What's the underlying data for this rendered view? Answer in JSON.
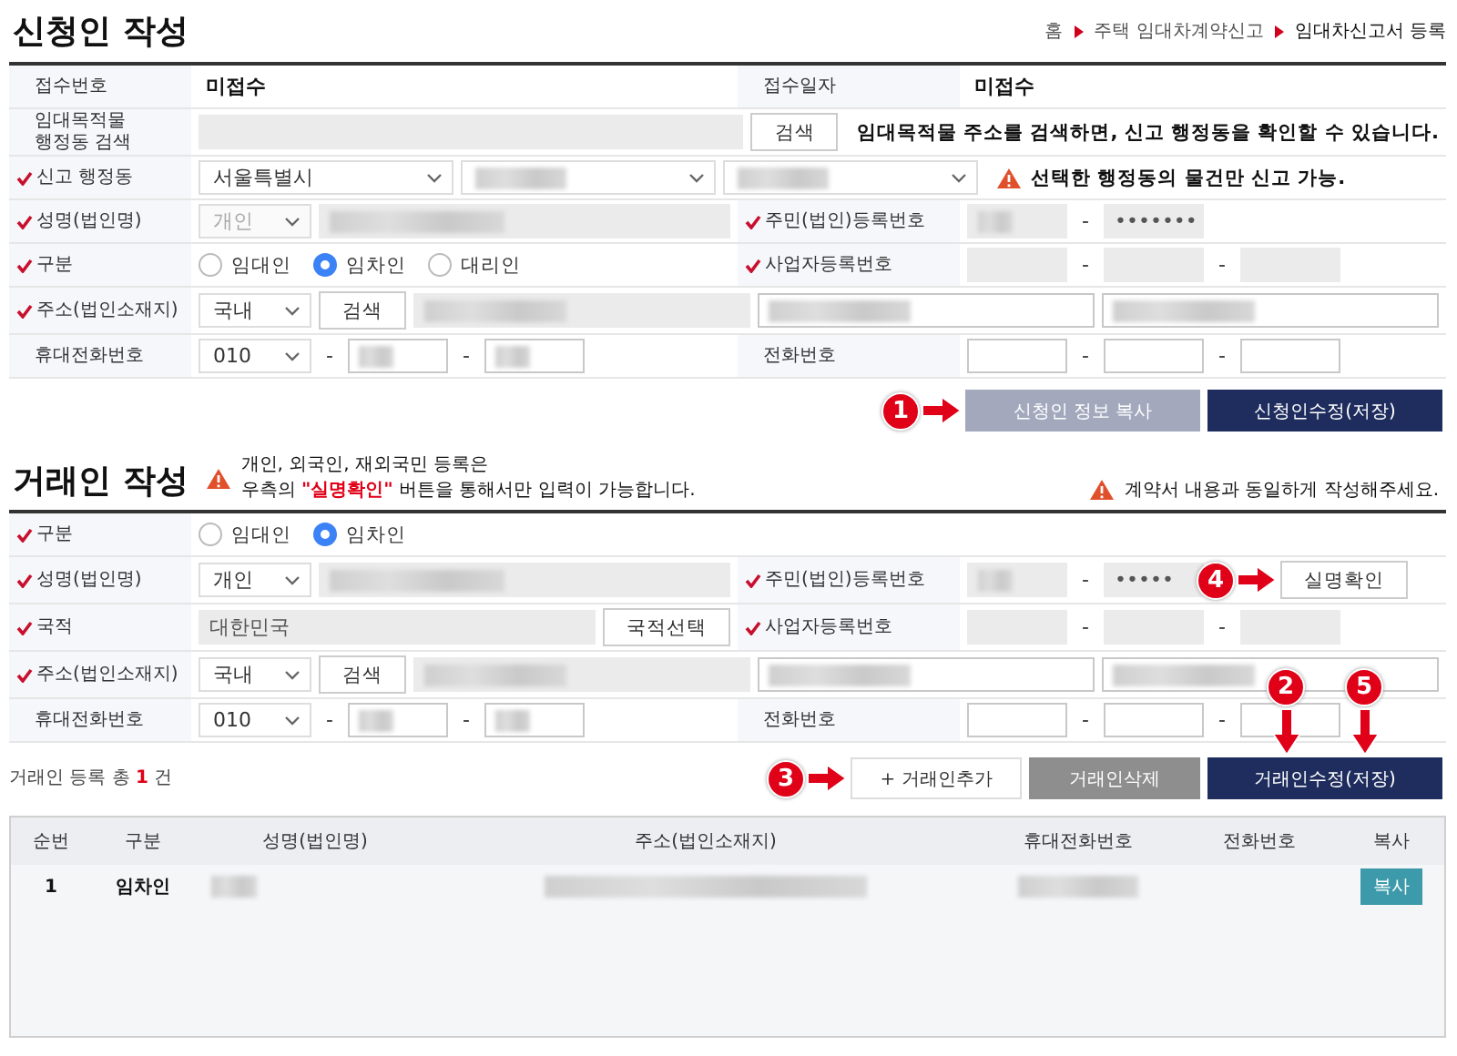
{
  "applicant": {
    "title": "신청인 작성",
    "breadcrumb": [
      "홈",
      "주택 임대차계약신고",
      "임대차신고서 등록"
    ],
    "rows": [
      {
        "cells": [
          {
            "label": "접수번호",
            "required": false,
            "items": [
              {
                "kind": "text",
                "text": "미접수"
              }
            ]
          },
          {
            "label": "접수일자",
            "required": false,
            "items": [
              {
                "kind": "text",
                "text": "미접수"
              }
            ]
          }
        ]
      },
      {
        "cells": [
          {
            "label": "임대목적물\n행정동 검색",
            "required": false,
            "items": [
              {
                "kind": "input",
                "readonly": true
              },
              {
                "kind": "button",
                "label": "검색"
              },
              {
                "kind": "note",
                "warning": false,
                "text": "임대목적물 주소를 검색하면, 신고 행정동을 확인할 수 있습니다."
              }
            ]
          }
        ]
      },
      {
        "cells": [
          {
            "label": "신고 행정동",
            "required": true,
            "items": [
              {
                "kind": "select",
                "value": "서울특별시",
                "disabled": false
              },
              {
                "kind": "select",
                "redacted": true,
                "disabled": false
              },
              {
                "kind": "select",
                "redacted": true,
                "disabled": false
              },
              {
                "kind": "note",
                "warning": true,
                "text": "선택한 행정동의 물건만 신고 가능."
              }
            ]
          }
        ]
      },
      {
        "cells": [
          {
            "label": "성명(법인명)",
            "required": true,
            "items": [
              {
                "kind": "select",
                "value": "개인",
                "disabled": true
              },
              {
                "kind": "input",
                "readonly": true,
                "redacted": true
              }
            ]
          },
          {
            "label": "주민(법인)등록번호",
            "required": true,
            "items": [
              {
                "kind": "input",
                "readonly": true,
                "redacted": true
              },
              {
                "kind": "dash",
                "text": "-"
              },
              {
                "kind": "input",
                "readonly": true,
                "value": "•••••••"
              }
            ]
          }
        ]
      },
      {
        "cells": [
          {
            "label": "구분",
            "required": true,
            "items": [
              {
                "kind": "radio",
                "options": [
                  {
                    "label": "임대인",
                    "selected": false
                  },
                  {
                    "label": "임차인",
                    "selected": true
                  },
                  {
                    "label": "대리인",
                    "selected": false
                  }
                ]
              }
            ]
          },
          {
            "label": "사업자등록번호",
            "required": true,
            "items": [
              {
                "kind": "input",
                "readonly": true
              },
              {
                "kind": "dash",
                "text": "-"
              },
              {
                "kind": "input",
                "readonly": true
              },
              {
                "kind": "dash",
                "text": "-"
              },
              {
                "kind": "input",
                "readonly": true
              }
            ]
          }
        ]
      },
      {
        "cells": [
          {
            "label": "주소(법인소재지)",
            "required": true,
            "items": [
              {
                "kind": "select",
                "value": "국내",
                "disabled": false
              },
              {
                "kind": "button",
                "label": "검색"
              },
              {
                "kind": "input",
                "readonly": true,
                "redacted": true
              },
              {
                "kind": "input",
                "readonly": false,
                "redacted": true
              },
              {
                "kind": "input",
                "readonly": false,
                "redacted": true
              }
            ]
          }
        ]
      },
      {
        "cells": [
          {
            "label": "휴대전화번호",
            "required": false,
            "items": [
              {
                "kind": "select",
                "value": "010",
                "disabled": false
              },
              {
                "kind": "dash",
                "text": "-"
              },
              {
                "kind": "input",
                "readonly": false,
                "redacted": true
              },
              {
                "kind": "dash",
                "text": "-"
              },
              {
                "kind": "input",
                "readonly": false,
                "redacted": true
              }
            ]
          },
          {
            "label": "전화번호",
            "required": false,
            "items": [
              {
                "kind": "input",
                "readonly": false
              },
              {
                "kind": "dash",
                "text": "-"
              },
              {
                "kind": "input",
                "readonly": false
              },
              {
                "kind": "dash",
                "text": "-"
              },
              {
                "kind": "input",
                "readonly": false
              }
            ]
          }
        ]
      }
    ],
    "buttons": [
      {
        "label": "신청인 정보 복사",
        "kind": "secondary",
        "callouts": [
          {
            "number": "1",
            "kind": "right"
          }
        ]
      },
      {
        "label": "신청인수정(저장)",
        "kind": "primary"
      }
    ]
  },
  "counterparty": {
    "title": "거래인 작성",
    "notice": "개인, 외국인, 재외국민 등록은\n우측의 **\"실명확인\"** 버튼을 통해서만 입력이 가능합니다.",
    "notice_right": "계약서 내용과 동일하게 작성해주세요.",
    "rows": [
      {
        "cells": [
          {
            "label": "구분",
            "required": true,
            "items": [
              {
                "kind": "radio",
                "options": [
                  {
                    "label": "임대인",
                    "selected": false
                  },
                  {
                    "label": "임차인",
                    "selected": true
                  }
                ]
              }
            ]
          }
        ]
      },
      {
        "cells": [
          {
            "label": "성명(법인명)",
            "required": true,
            "items": [
              {
                "kind": "select",
                "value": "개인",
                "disabled": false
              },
              {
                "kind": "input",
                "readonly": true,
                "redacted": true
              }
            ]
          },
          {
            "label": "주민(법인)등록번호",
            "required": true,
            "items": [
              {
                "kind": "input",
                "readonly": true,
                "redacted": true
              },
              {
                "kind": "dash",
                "text": "-"
              },
              {
                "kind": "input",
                "readonly": true,
                "value": "•••••"
              },
              {
                "kind": "button",
                "label": "실명확인",
                "callouts": [
                  {
                    "number": "4",
                    "kind": "right"
                  }
                ]
              }
            ]
          }
        ]
      },
      {
        "cells": [
          {
            "label": "국적",
            "required": true,
            "items": [
              {
                "kind": "input",
                "readonly": true,
                "value": "대한민국"
              },
              {
                "kind": "button",
                "label": "국적선택"
              }
            ]
          },
          {
            "label": "사업자등록번호",
            "required": true,
            "items": [
              {
                "kind": "input",
                "readonly": true
              },
              {
                "kind": "dash",
                "text": "-"
              },
              {
                "kind": "input",
                "readonly": true
              },
              {
                "kind": "dash",
                "text": "-"
              },
              {
                "kind": "input",
                "readonly": true
              }
            ]
          }
        ]
      },
      {
        "cells": [
          {
            "label": "주소(법인소재지)",
            "required": true,
            "items": [
              {
                "kind": "select",
                "value": "국내",
                "disabled": false
              },
              {
                "kind": "button",
                "label": "검색"
              },
              {
                "kind": "input",
                "readonly": true,
                "redacted": true
              },
              {
                "kind": "input",
                "readonly": false,
                "redacted": true
              },
              {
                "kind": "input",
                "readonly": false,
                "redacted": true
              }
            ]
          }
        ]
      },
      {
        "cells": [
          {
            "label": "휴대전화번호",
            "required": false,
            "items": [
              {
                "kind": "select",
                "value": "010",
                "disabled": false
              },
              {
                "kind": "dash",
                "text": "-"
              },
              {
                "kind": "input",
                "readonly": false,
                "redacted": true
              },
              {
                "kind": "dash",
                "text": "-"
              },
              {
                "kind": "input",
                "readonly": false,
                "redacted": true
              }
            ]
          },
          {
            "label": "전화번호",
            "required": false,
            "items": [
              {
                "kind": "input",
                "readonly": false
              },
              {
                "kind": "dash",
                "text": "-"
              },
              {
                "kind": "input",
                "readonly": false
              },
              {
                "kind": "dash",
                "text": "-"
              },
              {
                "kind": "input",
                "readonly": false
              }
            ]
          }
        ]
      }
    ],
    "count": "거래인 등록 총 **1** 건",
    "buttons": [
      {
        "label": "+ 거래인추가",
        "kind": "outline",
        "callouts": [
          {
            "number": "3",
            "kind": "right"
          }
        ]
      },
      {
        "label": "거래인삭제",
        "kind": "gray"
      },
      {
        "label": "거래인수정(저장)",
        "kind": "primary",
        "callouts": [
          {
            "number": "2",
            "kind": "down"
          },
          {
            "number": "5",
            "kind": "down"
          }
        ]
      }
    ],
    "table": {
      "columns": [
        "순번",
        "구분",
        "성명(법인명)",
        "주소(법인소재지)",
        "휴대전화번호",
        "전화번호",
        "복사"
      ],
      "rows": [
        {
          "cells": [
            {
              "kind": "text",
              "text": "1"
            },
            {
              "kind": "text",
              "text": "임차인"
            },
            {
              "kind": "redacted"
            },
            {
              "kind": "redacted"
            },
            {
              "kind": "redacted"
            },
            {
              "kind": "empty"
            },
            {
              "kind": "button",
              "label": "복사"
            }
          ]
        }
      ]
    }
  }
}
